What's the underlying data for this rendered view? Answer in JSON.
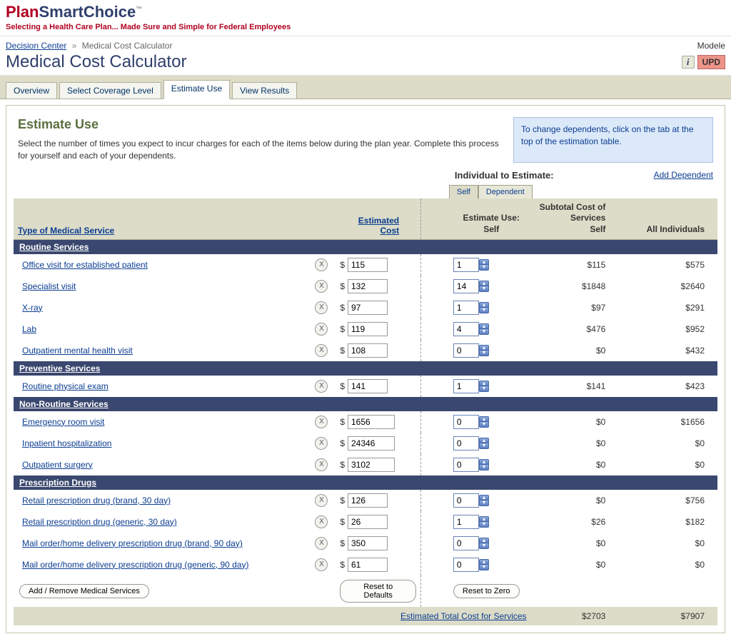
{
  "brand": {
    "plan": "Plan",
    "smart": "SmartChoice",
    "tm": "™",
    "tagline": "Selecting a Health Care Plan... Made Sure and Simple for Federal Employees"
  },
  "breadcrumb": {
    "decision_center": "Decision Center",
    "current": "Medical Cost Calculator"
  },
  "title": "Medical Cost Calculator",
  "top_right": {
    "modele": "Modele",
    "upd": "UPD"
  },
  "tabs": {
    "overview": "Overview",
    "select_coverage": "Select Coverage Level",
    "estimate_use": "Estimate Use",
    "view_results": "View Results"
  },
  "section": {
    "heading": "Estimate Use",
    "desc": "Select the number of times you expect to incur charges for each of the items below during the plan year. Complete this process for yourself and each of your dependents.",
    "hint": "To change dependents, click on the tab at the top of the estimation table."
  },
  "individual": {
    "label": "Individual to Estimate:",
    "add_dependent": "Add Dependent"
  },
  "inner_tabs": {
    "self": "Self",
    "dependent": "Dependent"
  },
  "col": {
    "type": "Type of Medical Service",
    "est_cost": "Estimated Cost",
    "est_use": "Estimate Use:",
    "est_use_self": "Self",
    "subtotal": "Subtotal Cost of Services",
    "self": "Self",
    "all": "All Individuals"
  },
  "groups": {
    "routine": "Routine Services",
    "preventive": "Preventive Services",
    "nonroutine": "Non-Routine Services",
    "rx": "Prescription Drugs"
  },
  "rows": {
    "office": {
      "label": "Office visit for established patient",
      "cost": "115",
      "use": "1",
      "self": "$115",
      "all": "$575"
    },
    "spec": {
      "label": "Specialist visit",
      "cost": "132",
      "use": "14",
      "self": "$1848",
      "all": "$2640"
    },
    "xray": {
      "label": "X-ray",
      "cost": "97",
      "use": "1",
      "self": "$97",
      "all": "$291"
    },
    "lab": {
      "label": "Lab",
      "cost": "119",
      "use": "4",
      "self": "$476",
      "all": "$952"
    },
    "opmh": {
      "label": "Outpatient mental health visit",
      "cost": "108",
      "use": "0",
      "self": "$0",
      "all": "$432"
    },
    "physical": {
      "label": "Routine physical exam",
      "cost": "141",
      "use": "1",
      "self": "$141",
      "all": "$423"
    },
    "er": {
      "label": "Emergency room visit",
      "cost": "1656",
      "use": "0",
      "self": "$0",
      "all": "$1656"
    },
    "inpat": {
      "label": "Inpatient hospitalization",
      "cost": "24346",
      "use": "0",
      "self": "$0",
      "all": "$0"
    },
    "opsurg": {
      "label": "Outpatient surgery",
      "cost": "3102",
      "use": "0",
      "self": "$0",
      "all": "$0"
    },
    "rxb30": {
      "label": "Retail prescription drug (brand, 30 day)",
      "cost": "126",
      "use": "0",
      "self": "$0",
      "all": "$756"
    },
    "rxg30": {
      "label": "Retail prescription drug (generic, 30 day)",
      "cost": "26",
      "use": "1",
      "self": "$26",
      "all": "$182"
    },
    "rxb90": {
      "label": "Mail order/home delivery prescription drug (brand, 90 day)",
      "cost": "350",
      "use": "0",
      "self": "$0",
      "all": "$0"
    },
    "rxg90": {
      "label": "Mail order/home delivery prescription drug (generic, 90 day)",
      "cost": "61",
      "use": "0",
      "self": "$0",
      "all": "$0"
    }
  },
  "buttons": {
    "add_remove": "Add / Remove Medical Services",
    "reset_defaults": "Reset to Defaults",
    "reset_zero": "Reset to Zero"
  },
  "total": {
    "label": "Estimated Total Cost for Services",
    "self": "$2703",
    "all": "$7907"
  }
}
